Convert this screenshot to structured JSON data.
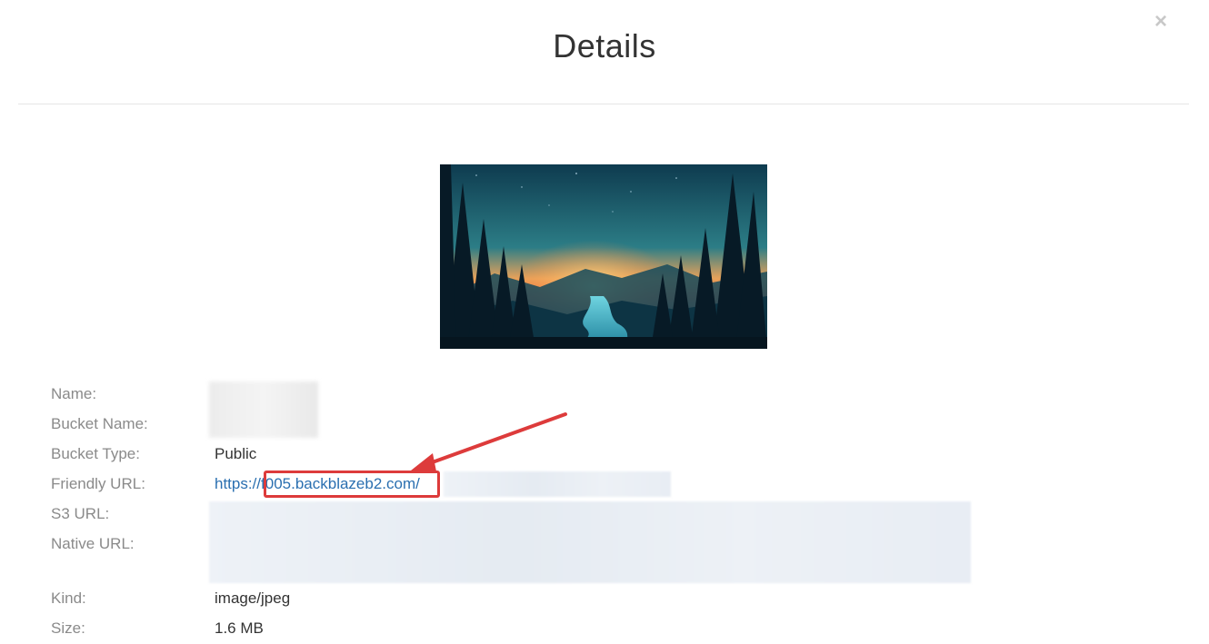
{
  "dialog": {
    "title": "Details",
    "close_glyph": "×"
  },
  "fields": {
    "name_label": "Name:",
    "bucket_name_label": "Bucket Name:",
    "bucket_type_label": "Bucket Type:",
    "bucket_type_value": "Public",
    "friendly_url_label": "Friendly URL:",
    "friendly_url_prefix": "https://",
    "friendly_url_host": "f005.backblazeb2.com",
    "friendly_url_slash": "/",
    "s3_url_label": "S3 URL:",
    "native_url_label": "Native URL:",
    "kind_label": "Kind:",
    "kind_value": "image/jpeg",
    "size_label": "Size:",
    "size_value": "1.6 MB"
  },
  "icons": {
    "close": "close-icon",
    "annotation": "red-arrow-annotation"
  },
  "colors": {
    "link": "#2a6fb0",
    "annotation": "#dd3b3b",
    "label": "#8a8a8a"
  }
}
